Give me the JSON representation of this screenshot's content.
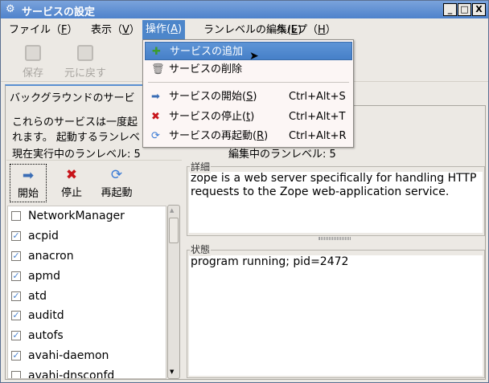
{
  "window": {
    "title": "サービスの設定",
    "minimize": "_",
    "maximize": "□",
    "close": "X"
  },
  "menubar": [
    {
      "label": "ファイル（",
      "key": "F",
      "end": "）"
    },
    {
      "label": "表示（",
      "key": "V",
      "end": "）"
    },
    {
      "label": "操作(",
      "key": "A",
      "end": ")"
    },
    {
      "label": "ランレベルの編集(",
      "key": "E",
      "end": ")"
    },
    {
      "label": "ヘルプ（",
      "key": "H",
      "end": "）"
    }
  ],
  "toolbar": {
    "save": "保存",
    "revert": "元に戻す"
  },
  "tab": {
    "label": "バックグラウンドのサービ"
  },
  "description": {
    "line1": "これらのサービスは一度起",
    "line2": "れます。 起動するランレベ"
  },
  "runlevel": {
    "current": "現在実行中のランレベル:  5",
    "editing": "編集中のランレベル:  5"
  },
  "actions": {
    "start": "開始",
    "stop": "停止",
    "restart": "再起動"
  },
  "services": [
    {
      "name": "NetworkManager",
      "checked": false
    },
    {
      "name": "acpid",
      "checked": true
    },
    {
      "name": "anacron",
      "checked": true
    },
    {
      "name": "apmd",
      "checked": true
    },
    {
      "name": "atd",
      "checked": true
    },
    {
      "name": "auditd",
      "checked": true
    },
    {
      "name": "autofs",
      "checked": true
    },
    {
      "name": "avahi-daemon",
      "checked": true
    },
    {
      "name": "avahi-dnsconfd",
      "checked": false
    }
  ],
  "details": {
    "label": "詳細",
    "text": "zope is a web server specifically for handling HTTP requests to the Zope web-application service."
  },
  "status": {
    "label": "状態",
    "text": "program running; pid=2472"
  },
  "action_menu": {
    "add": "サービスの追加",
    "delete": "サービスの削除",
    "start": {
      "label": "サービスの開始(",
      "key": "S",
      "end": ")",
      "shortcut": "Ctrl+Alt+S"
    },
    "stop": {
      "label": "サービスの停止(",
      "key": "t",
      "end": ")",
      "shortcut": "Ctrl+Alt+T"
    },
    "restart": {
      "label": "サービスの再起動(",
      "key": "R",
      "end": ")",
      "shortcut": "Ctrl+Alt+R"
    }
  },
  "colors": {
    "titlebar": "#4e82cb",
    "highlight": "#4d86ca",
    "check": "#4c85cf"
  }
}
